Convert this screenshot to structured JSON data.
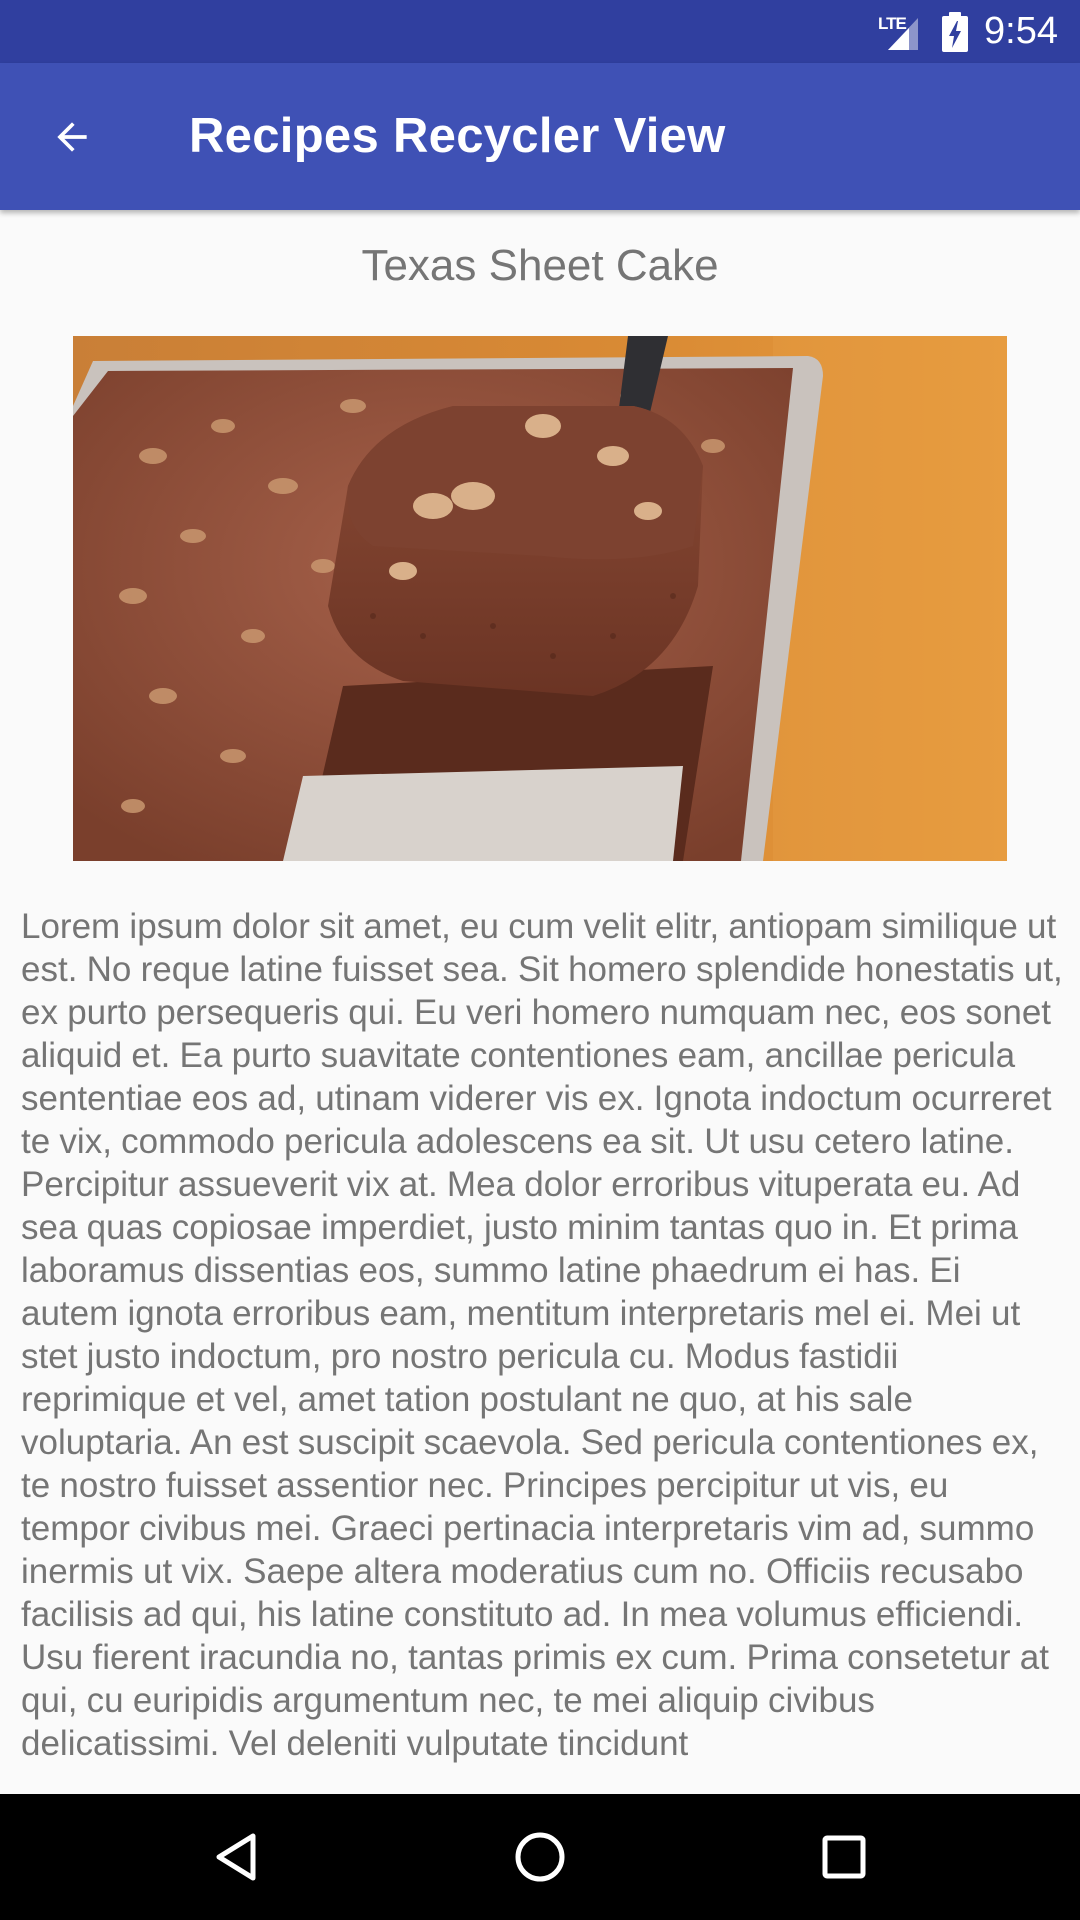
{
  "status_bar": {
    "network": "LTE",
    "time": "9:54",
    "icons": [
      "lte-signal-icon",
      "battery-charging-icon"
    ]
  },
  "app_bar": {
    "title": "Recipes Recycler View",
    "back_icon": "arrow-back-icon",
    "color": "#3f51b5"
  },
  "recipe": {
    "title": "Texas Sheet Cake",
    "image_alt": "chocolate-sheet-cake-photo",
    "description": "Lorem ipsum dolor sit amet, eu cum velit elitr, antiopam similique ut est. No reque latine fuisset sea. Sit homero splendide honestatis ut, ex purto persequeris qui. Eu veri homero numquam nec, eos sonet aliquid et. Ea purto suavitate contentiones eam, ancillae pericula sententiae eos ad, utinam viderer vis ex. Ignota indoctum ocurreret te vix, commodo pericula adolescens ea sit. Ut usu cetero latine. Percipitur assueverit vix at. Mea dolor erroribus vituperata eu. Ad sea quas copiosae imperdiet, justo minim tantas quo in. Et prima laboramus dissentias eos, summo latine phaedrum ei has. Ei autem ignota erroribus eam, mentitum interpretaris mel ei. Mei ut stet justo indoctum, pro nostro pericula cu. Modus fastidii reprimique et vel, amet tation postulant ne quo, at his sale voluptaria. An est suscipit scaevola. Sed pericula contentiones ex, te nostro fuisset assentior nec. Principes percipitur ut vis, eu tempor civibus mei. Graeci pertinacia interpretaris vim ad, summo inermis ut vix. Saepe altera moderatius cum no. Officiis recusabo facilisis ad qui, his latine constituto ad. In mea volumus efficiendi. Usu fierent iracundia no, tantas primis ex cum. Prima consetetur at qui, cu euripidis argumentum nec, te mei aliquip civibus delicatissimi. Vel deleniti vulputate tincidunt"
  },
  "nav_bar": {
    "buttons": [
      "back-triangle-icon",
      "home-circle-icon",
      "recents-square-icon"
    ]
  }
}
